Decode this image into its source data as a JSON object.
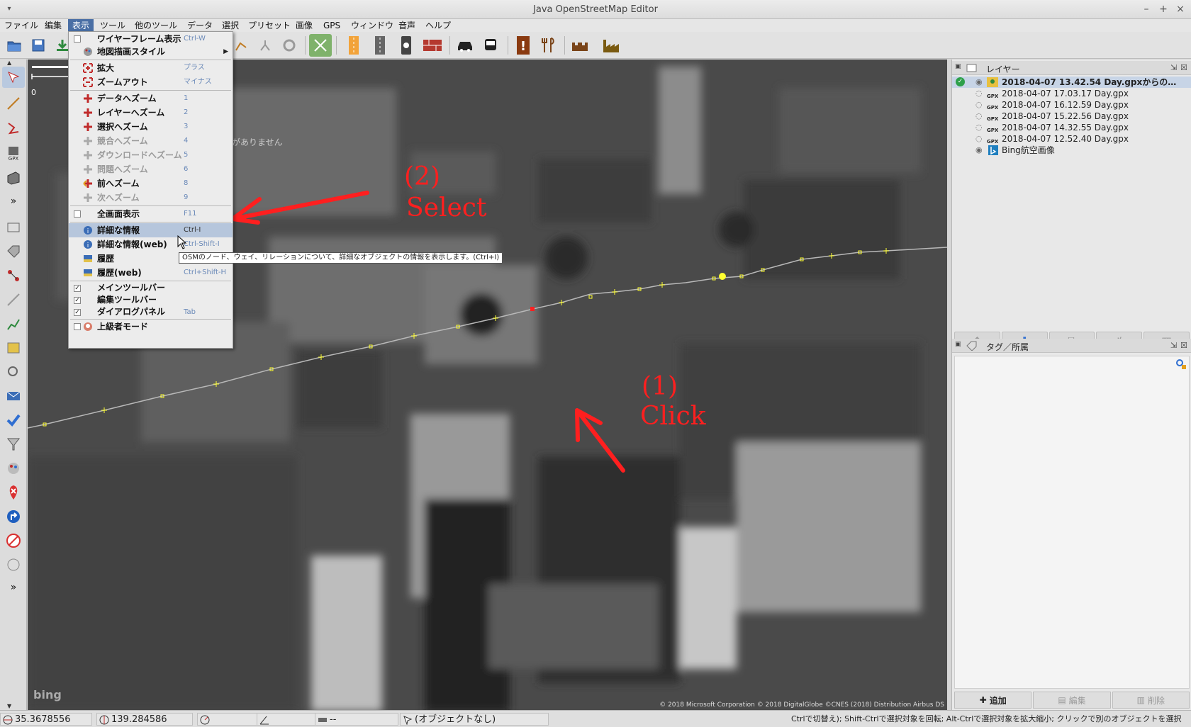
{
  "window": {
    "title": "Java OpenStreetMap Editor",
    "min": "–",
    "max": "+",
    "close": "×"
  },
  "menubar": [
    "ファイル",
    "編集",
    "表示",
    "ツール",
    "他のツール",
    "データ",
    "選択",
    "プリセット",
    "画像",
    "GPS",
    "ウィンドウ",
    "音声",
    "ヘルプ"
  ],
  "view_menu": {
    "items": [
      {
        "label": "ワイヤーフレーム表示",
        "shortcut": "Ctrl-W",
        "check": false
      },
      {
        "label": "地図描画スタイル",
        "submenu": true
      },
      {
        "label": "拡大",
        "shortcut": "プラス"
      },
      {
        "label": "ズームアウト",
        "shortcut": "マイナス"
      },
      {
        "label": "データへズーム",
        "shortcut": "1"
      },
      {
        "label": "レイヤーへズーム",
        "shortcut": "2"
      },
      {
        "label": "選択へズーム",
        "shortcut": "3"
      },
      {
        "label": "競合へズーム",
        "shortcut": "4",
        "disabled": true
      },
      {
        "label": "ダウンロードへズーム",
        "shortcut": "5",
        "disabled": true
      },
      {
        "label": "問題へズーム",
        "shortcut": "6",
        "disabled": true
      },
      {
        "label": "前へズーム",
        "shortcut": "8"
      },
      {
        "label": "次へズーム",
        "shortcut": "9",
        "disabled": true
      },
      {
        "label": "全画面表示",
        "shortcut": "F11",
        "check": false
      },
      {
        "label": "詳細な情報",
        "shortcut": "Ctrl-I",
        "highlighted": true
      },
      {
        "label": "詳細な情報(web)",
        "shortcut": "Ctrl-Shift-I"
      },
      {
        "label": "履歴",
        "shortcut": "Ctrl-H"
      },
      {
        "label": "履歴(web)",
        "shortcut": "Ctrl+Shift-H"
      },
      {
        "label": "メインツールバー",
        "check": true
      },
      {
        "label": "編集ツールバー",
        "check": true
      },
      {
        "label": "ダイアログパネル",
        "shortcut": "Tab",
        "check": true
      },
      {
        "label": "上級者モード",
        "check": false
      }
    ],
    "tooltip": "OSMのノード、ウェイ、リレーションについて、詳細なオブジェクトの情報を表示します。(Ctrl+I)"
  },
  "map": {
    "annotation_select_num": "(2)",
    "annotation_select": "Select",
    "annotation_click_num": "(1)",
    "annotation_click": "Click",
    "partial_text": "がありません",
    "scale_label": "0",
    "bing_logo": "bing",
    "copyright": "© 2018 Microsoft Corporation © 2018 DigitalGlobe ©CNES (2018) Distribution Airbus DS"
  },
  "layers_panel": {
    "title": "レイヤー",
    "layers": [
      {
        "name": "2018-04-07 13.42.54 Day.gpxからの…",
        "selected": true,
        "type": "data"
      },
      {
        "name": "2018-04-07 17.03.17 Day.gpx",
        "type": "gpx"
      },
      {
        "name": "2018-04-07 16.12.59 Day.gpx",
        "type": "gpx"
      },
      {
        "name": "2018-04-07 15.22.56 Day.gpx",
        "type": "gpx"
      },
      {
        "name": "2018-04-07 14.32.55 Day.gpx",
        "type": "gpx"
      },
      {
        "name": "2018-04-07 12.52.40 Day.gpx",
        "type": "gpx"
      },
      {
        "name": "Bing航空画像",
        "type": "bing"
      }
    ],
    "gpx_badge": "GPX"
  },
  "tags_panel": {
    "title": "タグ／所属",
    "add": "追加",
    "edit": "編集",
    "delete": "削除"
  },
  "statusbar": {
    "lat": "35.3678556",
    "lon": "139.284586",
    "heading": "",
    "angle": "",
    "distance": "--",
    "object": "(オブジェクトなし)",
    "help": "Ctrlで切替え); Shift-Ctrlで選択対象を回転; Alt-Ctrlで選択対象を拡大縮小; クリックで別のオブジェクトを選択"
  }
}
